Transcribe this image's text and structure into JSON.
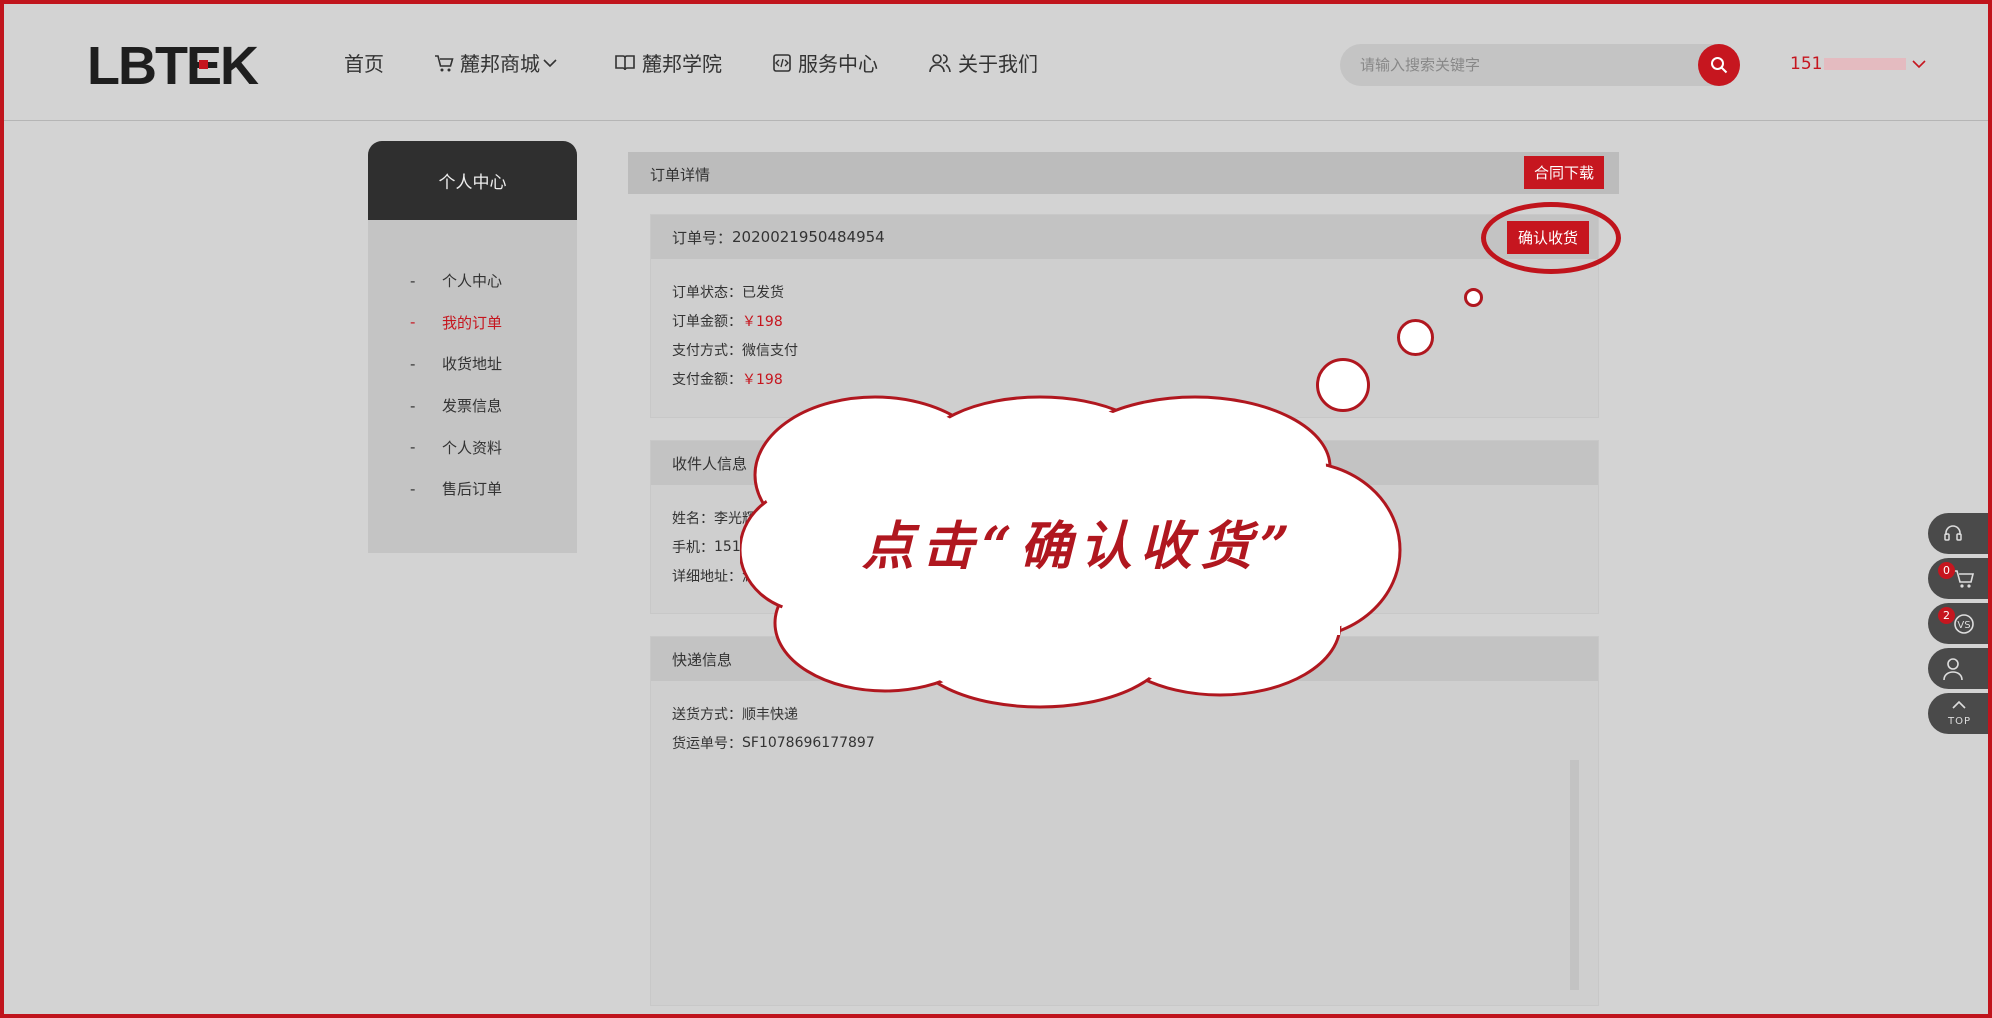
{
  "header": {
    "logo_text": "LBTEK",
    "nav": [
      {
        "label": "首页",
        "icon": ""
      },
      {
        "label": "麓邦商城",
        "icon": "cart-icon",
        "dropdown": true
      },
      {
        "label": "麓邦学院",
        "icon": "book-icon"
      },
      {
        "label": "服务中心",
        "icon": "code-icon"
      },
      {
        "label": "关于我们",
        "icon": "users-icon"
      }
    ],
    "search_placeholder": "请输入搜索关键字",
    "user_prefix": "151"
  },
  "sidebar": {
    "title": "个人中心",
    "items": [
      {
        "dash": "-",
        "label": "个人中心",
        "active": false
      },
      {
        "dash": "-",
        "label": "我的订单",
        "active": true
      },
      {
        "dash": "-",
        "label": "收货地址",
        "active": false
      },
      {
        "dash": "-",
        "label": "发票信息",
        "active": false
      },
      {
        "dash": "-",
        "label": "个人资料",
        "active": false
      },
      {
        "dash": "-",
        "label": "售后订单",
        "active": false
      }
    ]
  },
  "order_detail": {
    "title": "订单详情",
    "contract_button": "合同下载",
    "order_no_label": "订单号：",
    "order_no": "2020021950484954",
    "confirm_button": "确认收货",
    "status_label": "订单状态：",
    "status_value": "已发货",
    "amount_label": "订单金额：",
    "amount_value": "￥198",
    "pay_method_label": "支付方式：",
    "pay_method_value": "微信支付",
    "pay_amount_label": "支付金额：",
    "pay_amount_value": "￥198"
  },
  "receiver": {
    "title": "收件人信息",
    "name_label": "姓名：",
    "name_value": "李光辉",
    "phone_label": "手机：",
    "phone_value": "1511",
    "address_label": "详细地址：",
    "address_value": "湖南"
  },
  "shipping": {
    "title": "快递信息",
    "method_label": "送货方式：",
    "method_value": "顺丰快递",
    "tracking_label": "货运单号：",
    "tracking_value": "SF1078696177897"
  },
  "float_buttons": [
    {
      "icon": "headset-icon",
      "badge": ""
    },
    {
      "icon": "cart-icon",
      "badge": "0"
    },
    {
      "icon": "compare-icon",
      "badge": "2"
    },
    {
      "icon": "user-icon",
      "badge": ""
    },
    {
      "icon": "top-icon",
      "badge": "",
      "label": "TOP"
    }
  ],
  "annotation": {
    "text": "点击“确认收货”"
  },
  "colors": {
    "accent": "#c6161f",
    "background": "#d3d3d3",
    "sidebar_dark": "#2f2f2f"
  }
}
